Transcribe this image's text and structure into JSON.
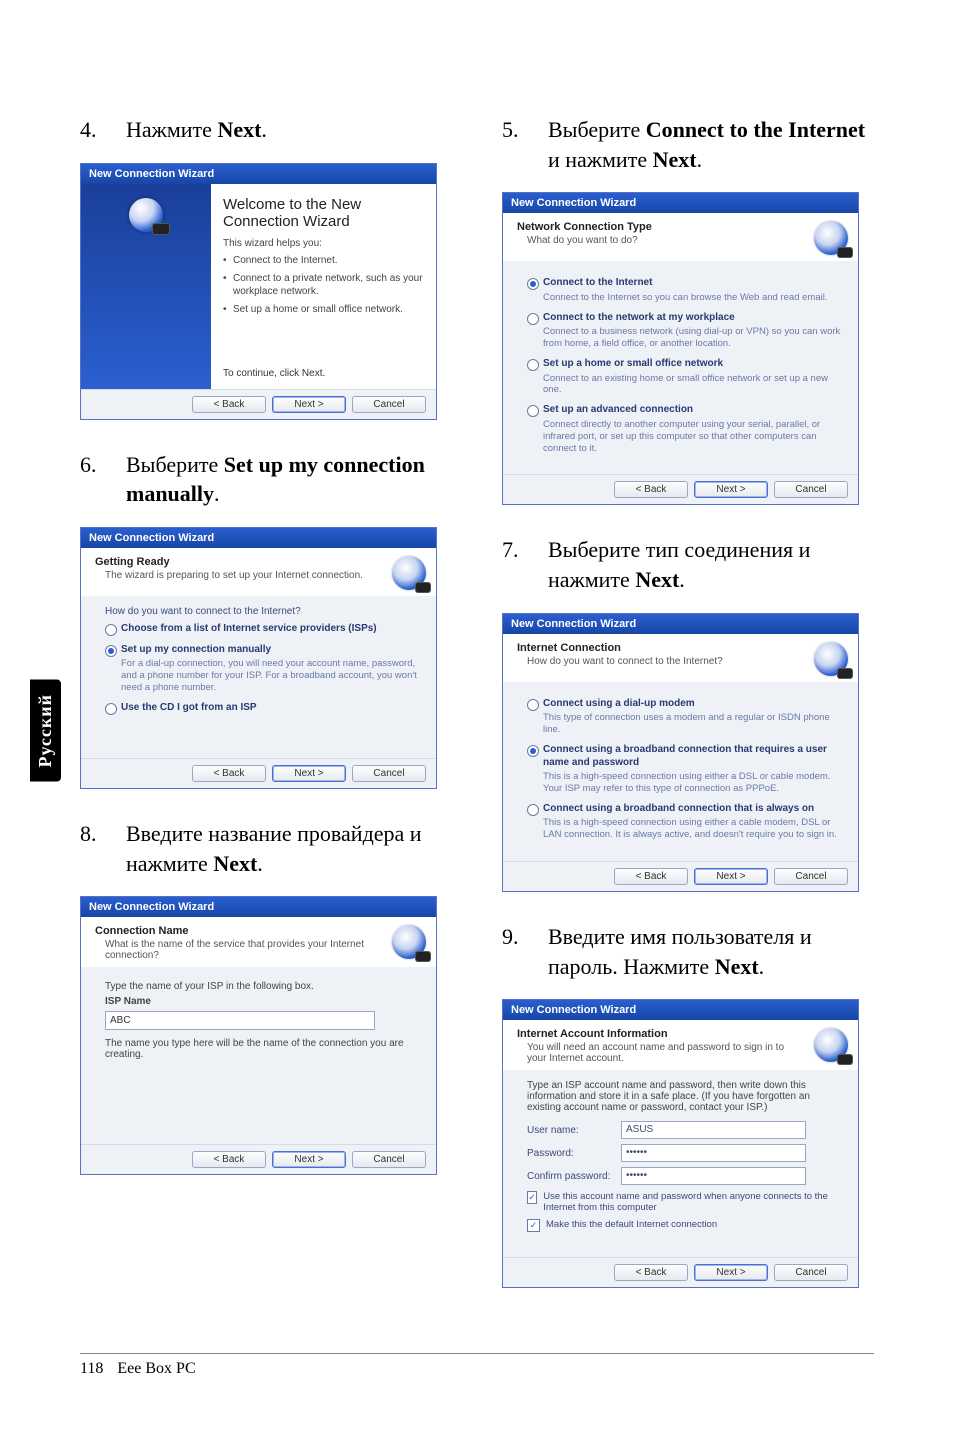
{
  "side_tab": "Русский",
  "footer": {
    "page": "118",
    "product": "Eee Box PC"
  },
  "steps": {
    "s4": {
      "num": "4.",
      "text_pre": "Нажмите ",
      "bold": "Next",
      "text_post": ".",
      "win": {
        "title": "New Connection Wizard",
        "h1": "Welcome to the New Connection Wizard",
        "p1": "This wizard helps you:",
        "li1": "Connect to the Internet.",
        "li2": "Connect to a private network, such as your workplace network.",
        "li3": "Set up a home or small office network.",
        "cont": "To continue, click Next.",
        "back": "< Back",
        "next": "Next >",
        "cancel": "Cancel"
      }
    },
    "s5": {
      "num": "5.",
      "text_pre": "Выберите ",
      "bold1": "Connect to the Internet",
      "mid": " и нажмите ",
      "bold2": "Next",
      "text_post": ".",
      "win": {
        "title": "New Connection Wizard",
        "head": "Network Connection Type",
        "sub": "What do you want to do?",
        "o1t": "Connect to the Internet",
        "o1d": "Connect to the Internet so you can browse the Web and read email.",
        "o2t": "Connect to the network at my workplace",
        "o2d": "Connect to a business network (using dial-up or VPN) so you can work from home, a field office, or another location.",
        "o3t": "Set up a home or small office network",
        "o3d": "Connect to an existing home or small office network or set up a new one.",
        "o4t": "Set up an advanced connection",
        "o4d": "Connect directly to another computer using your serial, parallel, or infrared port, or set up this computer so that other computers can connect to it.",
        "back": "< Back",
        "next": "Next >",
        "cancel": "Cancel"
      }
    },
    "s6": {
      "num": "6.",
      "text_pre": "Выберите ",
      "bold": "Set up my connection manually",
      "text_post": ".",
      "win": {
        "title": "New Connection Wizard",
        "head": "Getting Ready",
        "sub": "The wizard is preparing to set up your Internet connection.",
        "q": "How do you want to connect to the Internet?",
        "o1t": "Choose from a list of Internet service providers (ISPs)",
        "o2t": "Set up my connection manually",
        "o2d": "For a dial-up connection, you will need your account name, password, and a phone number for your ISP. For a broadband account, you won't need a phone number.",
        "o3t": "Use the CD I got from an ISP",
        "back": "< Back",
        "next": "Next >",
        "cancel": "Cancel"
      }
    },
    "s7": {
      "num": "7.",
      "text_pre": "Выберите тип соединения и нажмите  ",
      "bold": "Next",
      "text_post": ".",
      "win": {
        "title": "New Connection Wizard",
        "head": "Internet Connection",
        "sub": "How do you want to connect to the Internet?",
        "o1t": "Connect using a dial-up modem",
        "o1d": "This type of connection uses a modem and a regular or ISDN phone line.",
        "o2t": "Connect using a broadband connection that requires a user name and password",
        "o2d": "This is a high-speed connection using either a DSL or cable modem. Your ISP may refer to this type of connection as PPPoE.",
        "o3t": "Connect using a broadband connection that is always on",
        "o3d": "This is a high-speed connection using either a cable modem, DSL or LAN connection. It is always active, and doesn't require you to sign in.",
        "back": "< Back",
        "next": "Next >",
        "cancel": "Cancel"
      }
    },
    "s8": {
      "num": "8.",
      "text_pre": "Введите название провайдера и нажмите ",
      "bold": "Next",
      "text_post": ".",
      "win": {
        "title": "New Connection Wizard",
        "head": "Connection Name",
        "sub": "What is the name of the service that provides your Internet connection?",
        "label": "Type the name of your ISP in the following box.",
        "isp_lbl": "ISP Name",
        "isp_val": "ABC",
        "hint": "The name you type here will be the name of the connection you are creating.",
        "back": "< Back",
        "next": "Next >",
        "cancel": "Cancel"
      }
    },
    "s9": {
      "num": "9.",
      "text": "Введите имя пользователя и пароль. Нажмите ",
      "bold": "Next",
      "text_post": ".",
      "win": {
        "title": "New Connection Wizard",
        "head": "Internet Account Information",
        "sub": "You will need an account name and password to sign in to your Internet account.",
        "intro": "Type an ISP account name and password, then write down this information and store it in a safe place. (If you have forgotten an existing account name or password, contact your ISP.)",
        "user_l": "User name:",
        "user_v": "ASUS",
        "pass_l": "Password:",
        "pass_v": "••••••",
        "conf_l": "Confirm password:",
        "conf_v": "••••••",
        "chk1": "Use this account name and password when anyone connects to the Internet from this computer",
        "chk2": "Make this the default Internet connection",
        "back": "< Back",
        "next": "Next >",
        "cancel": "Cancel"
      }
    }
  }
}
